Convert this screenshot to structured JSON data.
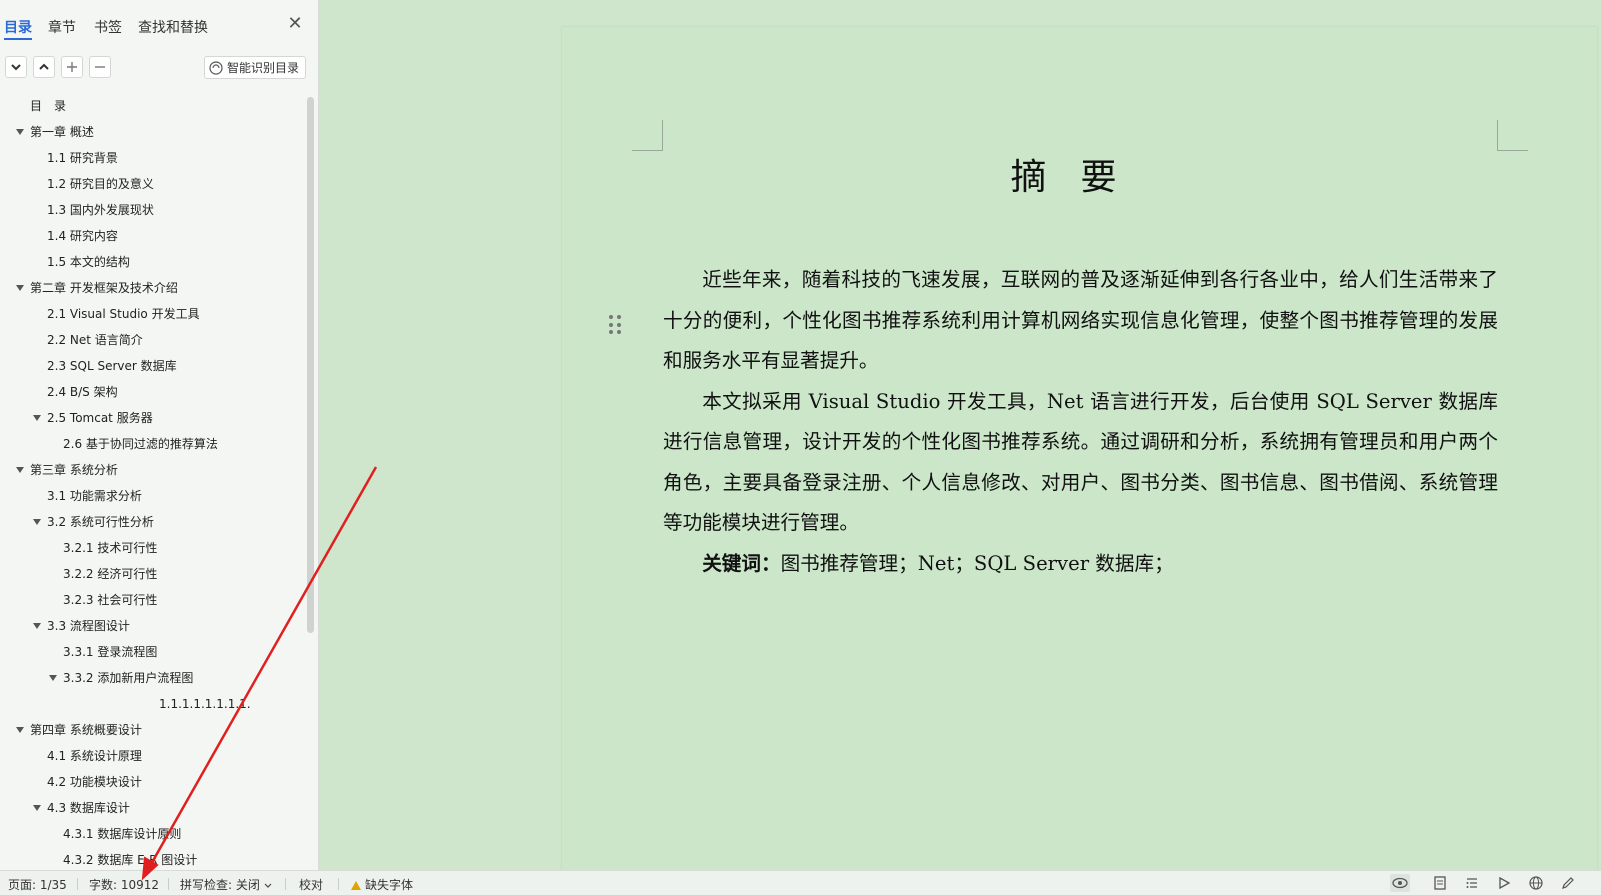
{
  "nav": {
    "tabs": [
      "目录",
      "章节",
      "书签",
      "查找和替换"
    ],
    "active_tab": "目录",
    "close_symbol": "✕",
    "smart_button": "智能识别目录",
    "toc": [
      {
        "label": "目　录",
        "level": 0,
        "caret": false
      },
      {
        "label": "第一章 概述",
        "level": 0,
        "caret": true
      },
      {
        "label": "1.1  研究背景",
        "level": 1,
        "caret": false
      },
      {
        "label": "1.2 研究目的及意义",
        "level": 1,
        "caret": false
      },
      {
        "label": "1.3 国内外发展现状",
        "level": 1,
        "caret": false
      },
      {
        "label": "1.4  研究内容",
        "level": 1,
        "caret": false
      },
      {
        "label": "1.5 本文的结构",
        "level": 1,
        "caret": false
      },
      {
        "label": " 第二章  开发框架及技术介绍",
        "level": 0,
        "caret": true
      },
      {
        "label": "2.1 Visual Studio 开发工具",
        "level": 1,
        "caret": false
      },
      {
        "label": "2.2 Net 语言简介",
        "level": 1,
        "caret": false
      },
      {
        "label": "2.3 SQL Server 数据库",
        "level": 1,
        "caret": false
      },
      {
        "label": "2.4 B/S 架构",
        "level": 1,
        "caret": false
      },
      {
        "label": "2.5 Tomcat 服务器",
        "level": 1,
        "caret": true
      },
      {
        "label": "2.6  基于协同过滤的推荐算法",
        "level": 2,
        "caret": false
      },
      {
        "label": "第三章  系统分析",
        "level": 0,
        "caret": true
      },
      {
        "label": "3.1 功能需求分析",
        "level": 1,
        "caret": false
      },
      {
        "label": "3.2 系统可行性分析",
        "level": 1,
        "caret": true
      },
      {
        "label": "3.2.1 技术可行性",
        "level": 2,
        "caret": false
      },
      {
        "label": "3.2.2  经济可行性",
        "level": 2,
        "caret": false
      },
      {
        "label": "3.2.3 社会可行性",
        "level": 2,
        "caret": false
      },
      {
        "label": "3.3 流程图设计",
        "level": 1,
        "caret": true
      },
      {
        "label": "3.3.1  登录流程图",
        "level": 2,
        "caret": false
      },
      {
        "label": "3.3.2  添加新用户流程图",
        "level": 2,
        "caret": true
      },
      {
        "label": "1.1.1.1.1.1.1.1.",
        "level": 4,
        "caret": false
      },
      {
        "label": "第四章  系统概要设计",
        "level": 0,
        "caret": true
      },
      {
        "label": "4.1 系统设计原理",
        "level": 1,
        "caret": false
      },
      {
        "label": "4.2 功能模块设计",
        "level": 1,
        "caret": false
      },
      {
        "label": "4.3  数据库设计",
        "level": 1,
        "caret": true
      },
      {
        "label": "4.3.1 数据库设计原则",
        "level": 2,
        "caret": false
      },
      {
        "label": " 4.3.2 数据库 E-R 图设计",
        "level": 2,
        "caret": false
      }
    ]
  },
  "document": {
    "title": "摘要",
    "paragraphs": [
      "近些年来，随着科技的飞速发展，互联网的普及逐渐延伸到各行各业中，给人们生活带来了十分的便利，个性化图书推荐系统利用计算机网络实现信息化管理，使整个图书推荐管理的发展和服务水平有显著提升。",
      "本文拟采用 Visual Studio 开发工具，Net 语言进行开发，后台使用 SQL Server 数据库进行信息管理，设计开发的个性化图书推荐系统。通过调研和分析，系统拥有管理员和用户两个角色，主要具备登录注册、个人信息修改、对用户、图书分类、图书信息、图书借阅、系统管理等功能模块进行管理。"
    ],
    "keywords_label": "关键词：",
    "keywords": "图书推荐管理；Net；SQL Server 数据库；"
  },
  "status": {
    "page": "页面: 1/35",
    "words": "字数: 10912",
    "spell": "拼写检查: 关闭",
    "proof": "校对",
    "missing_font": "缺失字体"
  },
  "colors": {
    "accent": "#2a6ad7",
    "page_bg": "#cbe6c9",
    "annotation": "#e02020"
  }
}
